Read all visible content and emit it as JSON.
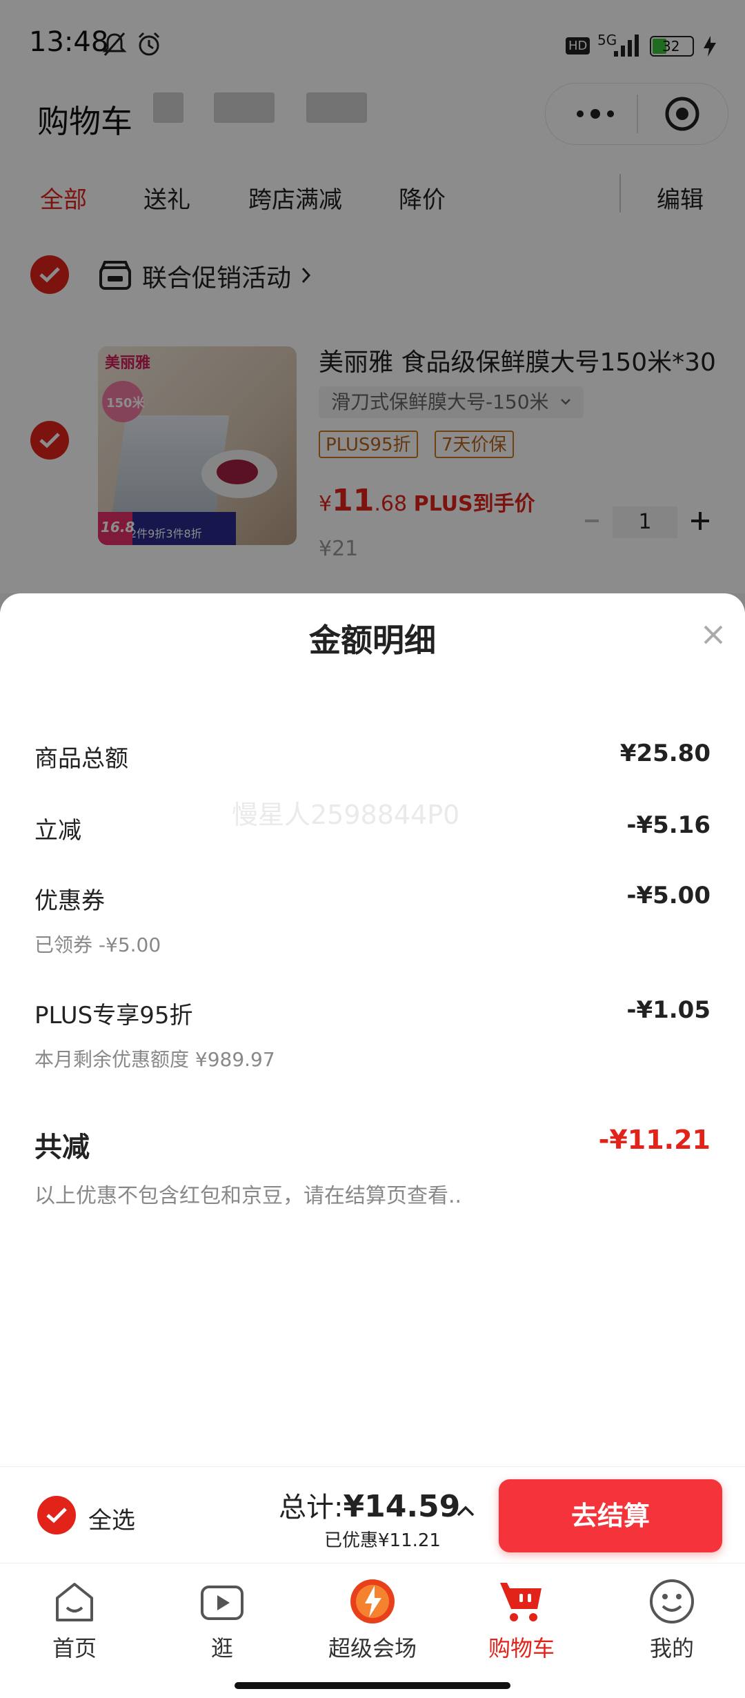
{
  "status_bar": {
    "time": "13:48",
    "battery": "32",
    "network": "5G",
    "hd": "HD"
  },
  "header": {
    "title": "购物车"
  },
  "tabs": [
    {
      "label": "全部",
      "active": true
    },
    {
      "label": "送礼"
    },
    {
      "label": "跨店满减"
    },
    {
      "label": "降价"
    }
  ],
  "edit_label": "编辑",
  "store": {
    "promo_label": "联合促销活动",
    "product": {
      "name": "美丽雅 食品级保鲜膜大号150米*30",
      "variant": "滑刀式保鲜膜大号-150米",
      "tags": [
        "PLUS95折",
        "7天价保"
      ],
      "price_symbol": "¥",
      "price_int": "11",
      "price_dec": ".68",
      "price_note": "PLUS到手价",
      "original_price": "¥21",
      "quantity": "1",
      "image_texts": {
        "brand": "美丽雅",
        "size": "150米",
        "promo": "2件9折3件8折",
        "price": "16.8"
      }
    }
  },
  "sheet": {
    "title": "金额明细",
    "rows": [
      {
        "label": "商品总额",
        "value": "¥25.80"
      },
      {
        "label": "立减",
        "value": "-¥5.16"
      },
      {
        "label": "优惠券",
        "value": "-¥5.00",
        "sub": "已领券 -¥5.00"
      },
      {
        "label": "PLUS专享95折",
        "value": "-¥1.05",
        "sub": "本月剩余优惠额度 ¥989.97"
      }
    ],
    "total_label": "共减",
    "total_value": "-¥11.21",
    "note": "以上优惠不包含红包和京豆，请在结算页查看..",
    "watermark": "慢星人2598844P0"
  },
  "checkout": {
    "select_all_label": "全选",
    "total_prefix": "总计:",
    "total_amount": "¥14.59",
    "saved": "已优惠¥11.21",
    "button_label": "去结算"
  },
  "nav": [
    {
      "label": "首页",
      "icon": "home-icon"
    },
    {
      "label": "逛",
      "icon": "video-icon"
    },
    {
      "label": "超级会场",
      "icon": "super-venue-icon"
    },
    {
      "label": "购物车",
      "icon": "cart-icon",
      "active": true
    },
    {
      "label": "我的",
      "icon": "profile-icon"
    }
  ],
  "colors": {
    "accent": "#e2231a",
    "checkout_button": "#f4343a",
    "tag_border": "#c9781f"
  }
}
